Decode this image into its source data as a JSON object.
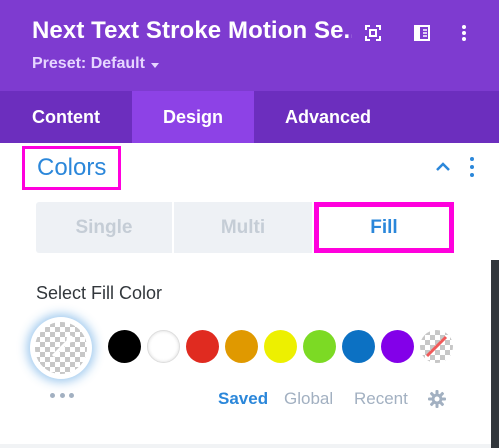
{
  "header": {
    "title": "Next Text Stroke Motion Se...",
    "preset_label": "Preset: Default",
    "icons": [
      "expand-icon",
      "split-view-icon",
      "kebab-icon"
    ],
    "background": "#7e3bd0"
  },
  "tabs": [
    {
      "label": "Content",
      "active": false
    },
    {
      "label": "Design",
      "active": true
    },
    {
      "label": "Advanced",
      "active": false
    }
  ],
  "section": {
    "title": "Colors",
    "collapse_icon": "chevron-up-icon",
    "menu_icon": "kebab-icon"
  },
  "color_mode": {
    "options": [
      "Single",
      "Multi",
      "Fill"
    ],
    "selected": "Fill"
  },
  "fill": {
    "label": "Select Fill Color",
    "current_color": "transparent",
    "swatches": [
      {
        "name": "black",
        "color": "#000000"
      },
      {
        "name": "white",
        "color": "#ffffff"
      },
      {
        "name": "red",
        "color": "#e02b20"
      },
      {
        "name": "orange",
        "color": "#e09900"
      },
      {
        "name": "yellow",
        "color": "#edf000"
      },
      {
        "name": "green",
        "color": "#7cda24"
      },
      {
        "name": "blue",
        "color": "#0c71c3"
      },
      {
        "name": "purple",
        "color": "#8300e9"
      },
      {
        "name": "none",
        "color": "transparent"
      }
    ],
    "palette_tabs": [
      "Saved",
      "Global",
      "Recent"
    ],
    "active_palette": "Saved"
  },
  "colors": {
    "accent": "#2b87da",
    "highlight": "#ff00dd",
    "tab_bar": "#6c2ebe",
    "active_tab": "#8d42e6"
  }
}
